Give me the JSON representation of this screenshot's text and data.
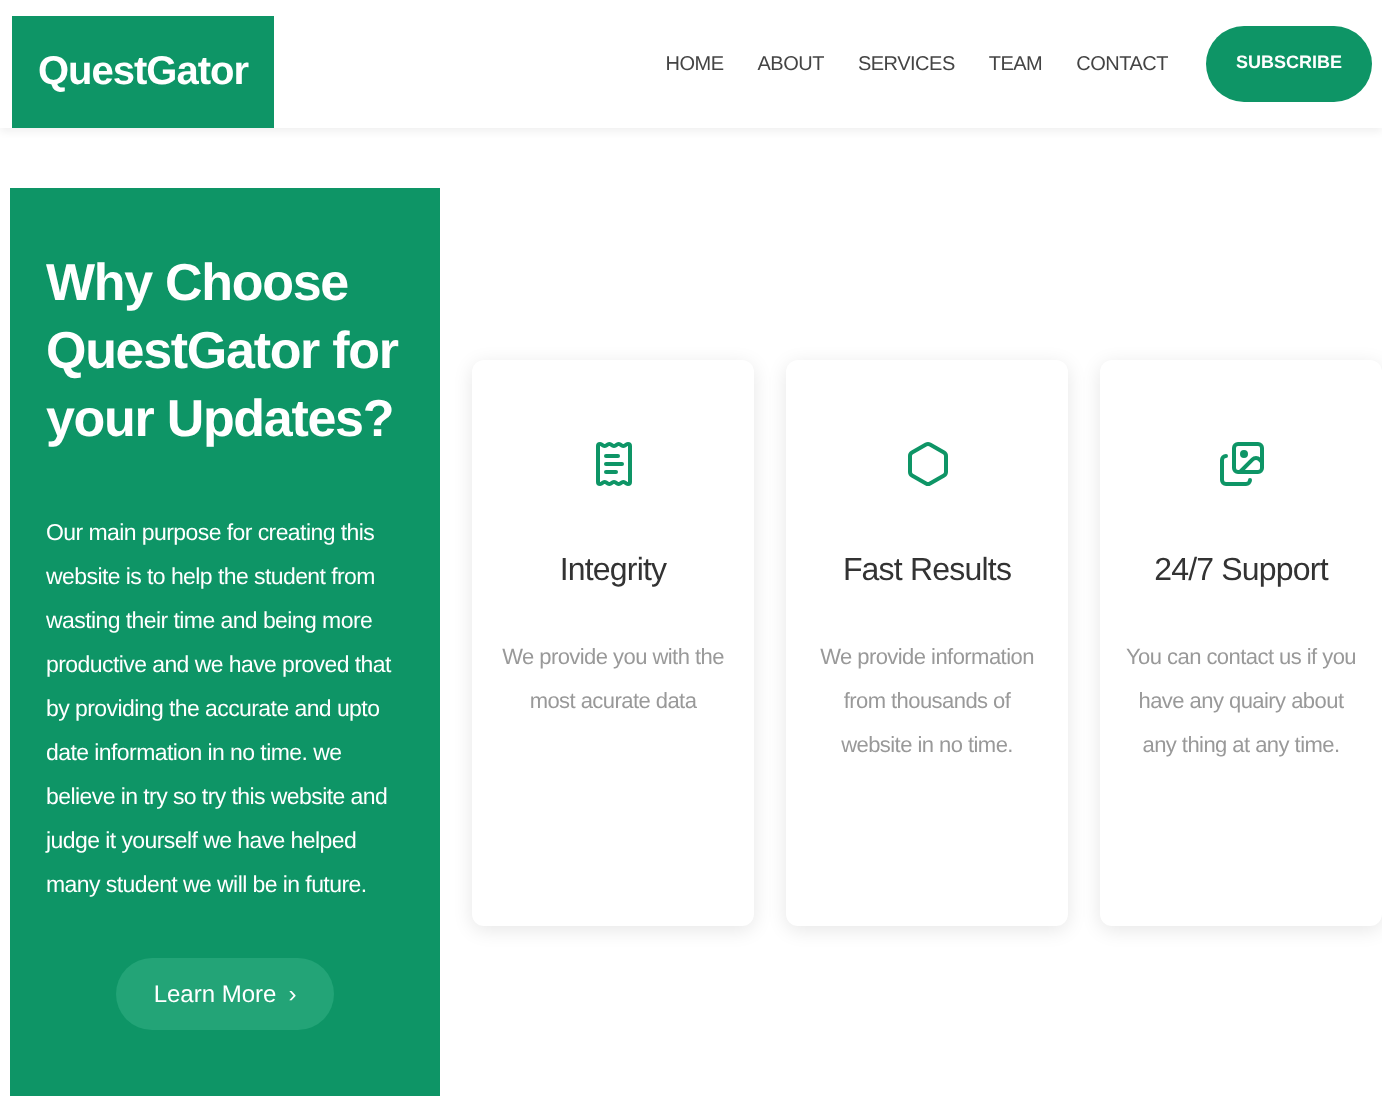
{
  "header": {
    "logo": "QuestGator",
    "nav": [
      "HOME",
      "ABOUT",
      "SERVICES",
      "TEAM",
      "CONTACT"
    ],
    "cta": "SUBSCRIBE"
  },
  "intro": {
    "title": "Why Choose QuestGator for your Updates?",
    "text": "Our main purpose for creating this website is to help the student from wasting their time and being more productive and we have proved that by providing the accurate and upto date information in no time. we believe in try so try this website and judge it yourself we have helped many student we will be in future.",
    "button": "Learn More",
    "button_icon": "›"
  },
  "features": [
    {
      "title": "Integrity",
      "text": "We provide you with the most acurate data"
    },
    {
      "title": "Fast Results",
      "text": "We provide information from thousands of website in no time."
    },
    {
      "title": "24/7 Support",
      "text": "You can contact us if you have any quairy about any thing at any time."
    }
  ]
}
